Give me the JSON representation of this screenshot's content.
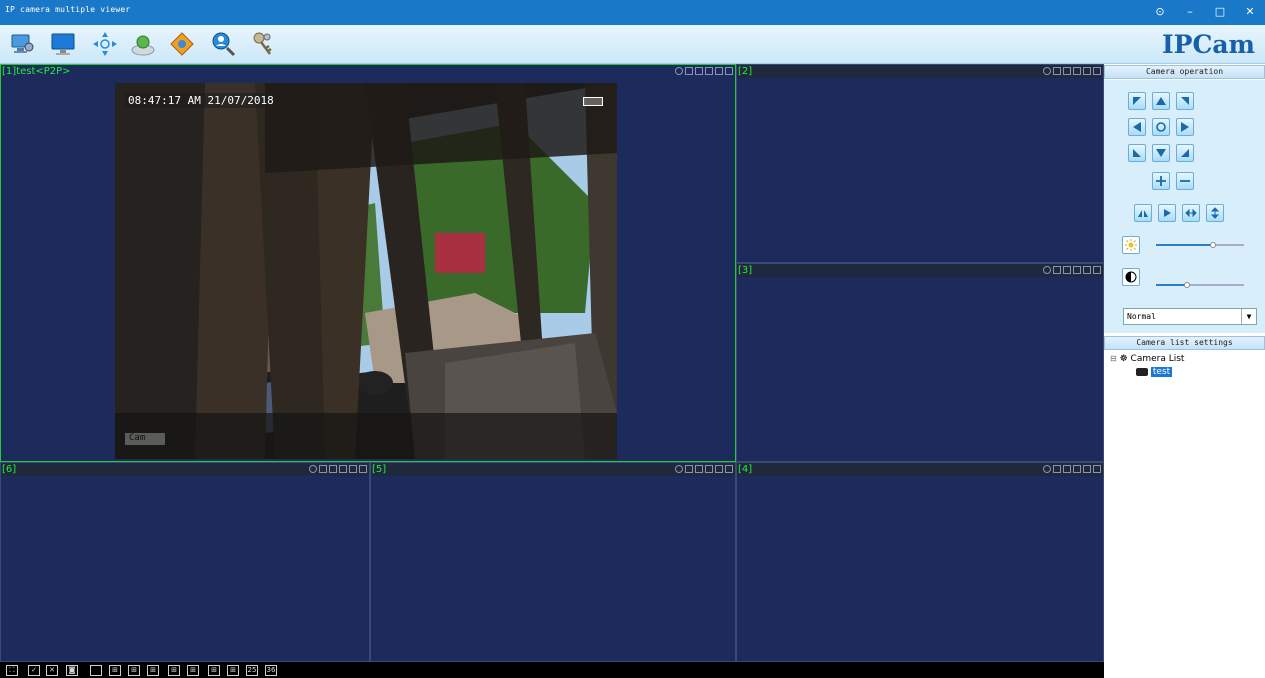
{
  "window": {
    "title": "IP camera multiple viewer",
    "controls": [
      "⊙",
      "–",
      "□",
      "✕"
    ]
  },
  "toolbar": {
    "icons": [
      "monitor-search-icon",
      "monitor-icon",
      "ptz-arrows-icon",
      "user-camera-icon",
      "settings-diamond-icon",
      "search-user-icon",
      "keys-icon"
    ],
    "brand": "IPCam"
  },
  "panes": [
    {
      "label": "[1]test<P2P>",
      "active": true
    },
    {
      "label": "[2]"
    },
    {
      "label": "[3]"
    },
    {
      "label": "[4]"
    },
    {
      "label": "[5]"
    },
    {
      "label": "[6]"
    }
  ],
  "feed": {
    "timestamp": "08:47:17 AM 21/07/2018",
    "cam_label": "Cam"
  },
  "sidebar": {
    "camera_operation": "Camera operation",
    "mode_select": "Normal",
    "camera_list_settings": "Camera list settings",
    "tree_root": "Camera List",
    "tree_item": "test",
    "brightness_level": 0.65,
    "contrast_level": 0.35
  },
  "bottombar": {
    "buttons": [
      "fullscreen",
      "check-all",
      "close-all",
      "snapshot",
      "1",
      "4",
      "6",
      "8",
      "9",
      "10",
      "13",
      "16",
      "25",
      "36"
    ],
    "labels": {
      "25": "25",
      "36": "36"
    }
  },
  "colors": {
    "title_bar": "#1a78c8",
    "pane_bg": "#1c2a5c",
    "active_border": "#22cc33",
    "label_green": "#22ee33"
  }
}
